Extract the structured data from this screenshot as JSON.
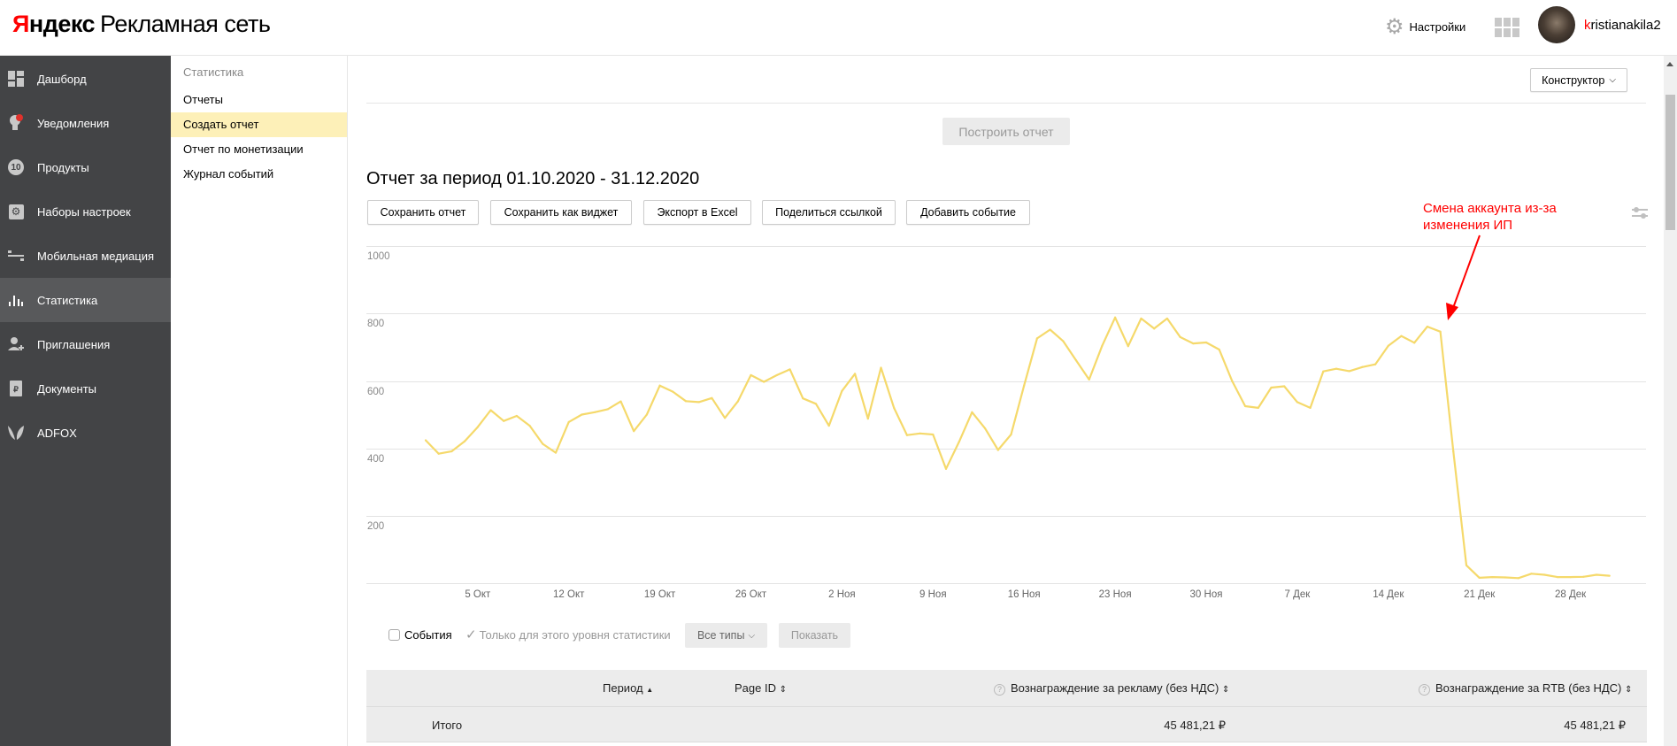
{
  "header": {
    "logo_brand": "Яндекс",
    "logo_brand_first": "Я",
    "logo_brand_rest": "ндекс",
    "logo_product": "Рекламная сеть",
    "settings_label": "Настройки",
    "username_first": "k",
    "username_rest": "ristianakila2",
    "accent_color": "#ff0000"
  },
  "sidebar": {
    "items": [
      {
        "label": "Дашборд",
        "icon": "dashboard-icon"
      },
      {
        "label": "Уведомления",
        "icon": "notification-bulb-icon"
      },
      {
        "label": "Продукты",
        "icon": "products-badge-icon",
        "badge": "10"
      },
      {
        "label": "Наборы настроек",
        "icon": "settings-set-icon"
      },
      {
        "label": "Мобильная медиация",
        "icon": "mediation-icon"
      },
      {
        "label": "Статистика",
        "icon": "bar-stats-icon",
        "active": true
      },
      {
        "label": "Приглашения",
        "icon": "user-plus-icon"
      },
      {
        "label": "Документы",
        "icon": "document-ruble-icon"
      },
      {
        "label": "ADFOX",
        "icon": "adfox-leaf-icon"
      }
    ]
  },
  "submenu": {
    "title": "Статистика",
    "items": [
      {
        "label": "Отчеты"
      },
      {
        "label": "Создать отчет",
        "active": true
      },
      {
        "label": "Отчет по монетизации"
      },
      {
        "label": "Журнал событий"
      }
    ]
  },
  "main": {
    "constructor_label": "Конструктор",
    "build_report_label": "Построить отчет",
    "report_title": "Отчет за период 01.10.2020 - 31.12.2020",
    "actions": [
      "Сохранить отчет",
      "Сохранить как виджет",
      "Экспорт в Excel",
      "Поделиться ссылкой",
      "Добавить событие"
    ],
    "annotation_line1": "Смена аккаунта из-за",
    "annotation_line2": "изменения ИП",
    "annotation_color": "#ff0000",
    "events_label": "События",
    "events_checked": false,
    "only_level_label": "Только для этого уровня статистики",
    "only_level_checked": true,
    "all_types_label": "Все типы",
    "show_label": "Показать"
  },
  "table": {
    "columns": [
      "Период",
      "Page ID",
      "Вознаграждение за рекламу (без НДС)",
      "Вознаграждение за RTB (без НДС)"
    ],
    "sort_asc": "▲",
    "sort_both": "⇕",
    "help": "?",
    "total_label": "Итого",
    "total_ad_reward": "45 481,21 ₽",
    "total_rtb_reward": "45 481,21 ₽"
  },
  "chart_data": {
    "type": "line",
    "title": "",
    "xlabel": "",
    "ylabel": "",
    "ylim": [
      0,
      1000
    ],
    "y_ticks": [
      "200",
      "400",
      "600",
      "800",
      "1000"
    ],
    "x_start": "01.10.2020",
    "x_end": "31.12.2020",
    "x_tick_labels": [
      {
        "label": "5 Окт",
        "index": 4
      },
      {
        "label": "12 Окт",
        "index": 11
      },
      {
        "label": "19 Окт",
        "index": 18
      },
      {
        "label": "26 Окт",
        "index": 25
      },
      {
        "label": "2 Ноя",
        "index": 32
      },
      {
        "label": "9 Ноя",
        "index": 39
      },
      {
        "label": "16 Ноя",
        "index": 46
      },
      {
        "label": "23 Ноя",
        "index": 53
      },
      {
        "label": "30 Ноя",
        "index": 60
      },
      {
        "label": "7 Дек",
        "index": 67
      },
      {
        "label": "14 Дек",
        "index": 74
      },
      {
        "label": "21 Дек",
        "index": 81
      },
      {
        "label": "28 Дек",
        "index": 88
      }
    ],
    "grid": true,
    "series": [
      {
        "name": "Вознаграждение",
        "color": "#f5d96b",
        "values": [
          424,
          384,
          391,
          421,
          463,
          513,
          481,
          496,
          467,
          413,
          387,
          478,
          500,
          507,
          516,
          539,
          451,
          500,
          586,
          568,
          540,
          537,
          549,
          490,
          539,
          617,
          597,
          617,
          634,
          548,
          532,
          467,
          570,
          621,
          488,
          639,
          520,
          439,
          444,
          441,
          339,
          419,
          507,
          459,
          395,
          441,
          586,
          726,
          752,
          718,
          661,
          604,
          704,
          788,
          703,
          785,
          755,
          785,
          730,
          711,
          714,
          693,
          599,
          525,
          520,
          580,
          584,
          537,
          520,
          628,
          636,
          629,
          641,
          649,
          704,
          733,
          713,
          761,
          746,
          390,
          53,
          16,
          18,
          17,
          15,
          28,
          25,
          18,
          18,
          19,
          25,
          22
        ]
      }
    ]
  }
}
